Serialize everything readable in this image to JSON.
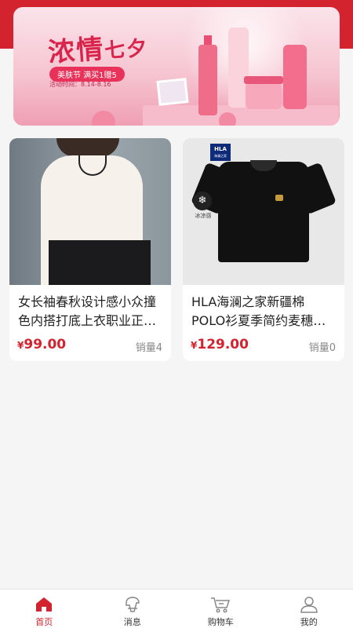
{
  "banner": {
    "title_main": "浓情",
    "title_accent": "七夕",
    "tag": "美肤节 满买1赠5",
    "date": "活动时间：8.14-8.16"
  },
  "products": [
    {
      "name": "女长袖春秋设计感小众撞色内搭打底上衣职业正…",
      "currency": "¥",
      "price": "99.00",
      "sales": "销量4"
    },
    {
      "name": "HLA海澜之家新疆棉POLO衫夏季简约麦穗刺绣…",
      "currency": "¥",
      "price": "129.00",
      "sales": "销量0",
      "brand_tag": "HLA",
      "brand_sub": "海澜之家",
      "badge_label": "冰凉感"
    }
  ],
  "tabbar": {
    "items": [
      {
        "label": "首页",
        "icon": "home-icon",
        "active": true
      },
      {
        "label": "消息",
        "icon": "message-icon",
        "active": false
      },
      {
        "label": "购物车",
        "icon": "cart-icon",
        "active": false
      },
      {
        "label": "我的",
        "icon": "user-icon",
        "active": false
      }
    ]
  },
  "colors": {
    "accent": "#d3232e",
    "background": "#f5f5f5",
    "inactive_icon": "#888888"
  }
}
